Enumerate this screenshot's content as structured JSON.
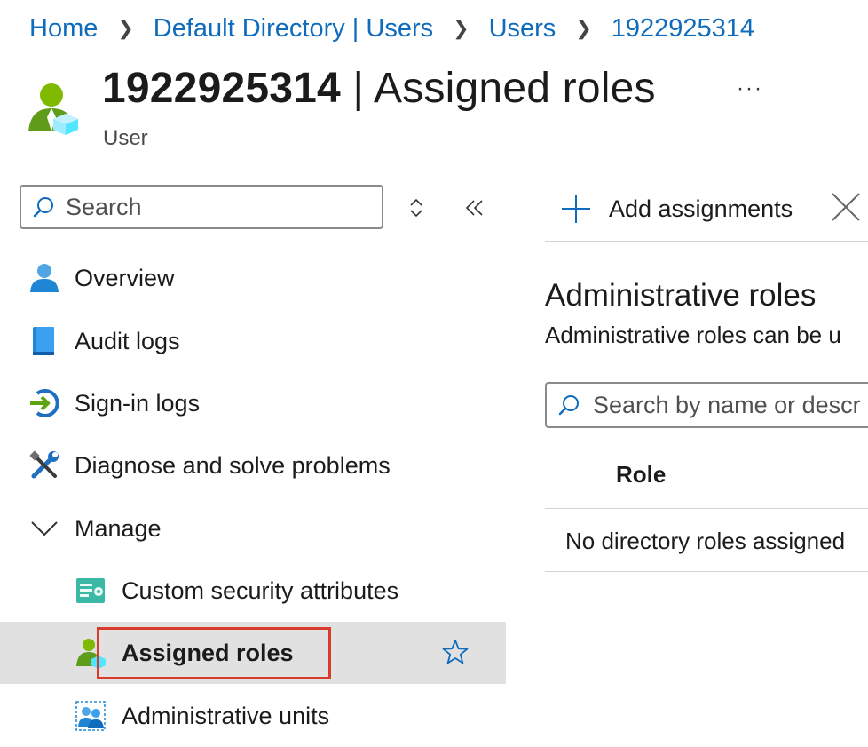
{
  "breadcrumb": [
    "Home",
    "Default Directory | Users",
    "Users",
    "1922925314"
  ],
  "header": {
    "title_id": "1922925314",
    "title_sep": " | ",
    "title_page": "Assigned roles",
    "subtitle": "User",
    "more": "···"
  },
  "left_search": {
    "placeholder": "Search"
  },
  "nav": {
    "items": [
      {
        "label": "Overview",
        "icon": "user-icon"
      },
      {
        "label": "Audit logs",
        "icon": "book-icon"
      },
      {
        "label": "Sign-in logs",
        "icon": "sign-in-arrow-icon"
      },
      {
        "label": "Diagnose and solve problems",
        "icon": "wrench-screwdriver-icon"
      },
      {
        "label": "Manage",
        "icon": "chevron-down-icon"
      }
    ],
    "sub_items": [
      {
        "label": "Custom security attributes",
        "icon": "security-attributes-icon"
      },
      {
        "label": "Assigned roles",
        "icon": "assigned-roles-icon",
        "selected": true
      },
      {
        "label": "Administrative units",
        "icon": "admin-units-icon"
      }
    ]
  },
  "toolbar": {
    "add_label": "Add assignments"
  },
  "roles": {
    "heading": "Administrative roles",
    "description": "Administrative roles can be u",
    "search_placeholder": "Search by name or descr",
    "column_role": "Role",
    "empty_text": "No directory roles assigned"
  },
  "colors": {
    "link": "#0f6cbd",
    "selected_bg": "#e1e1e1",
    "highlight": "#d83b2b"
  }
}
